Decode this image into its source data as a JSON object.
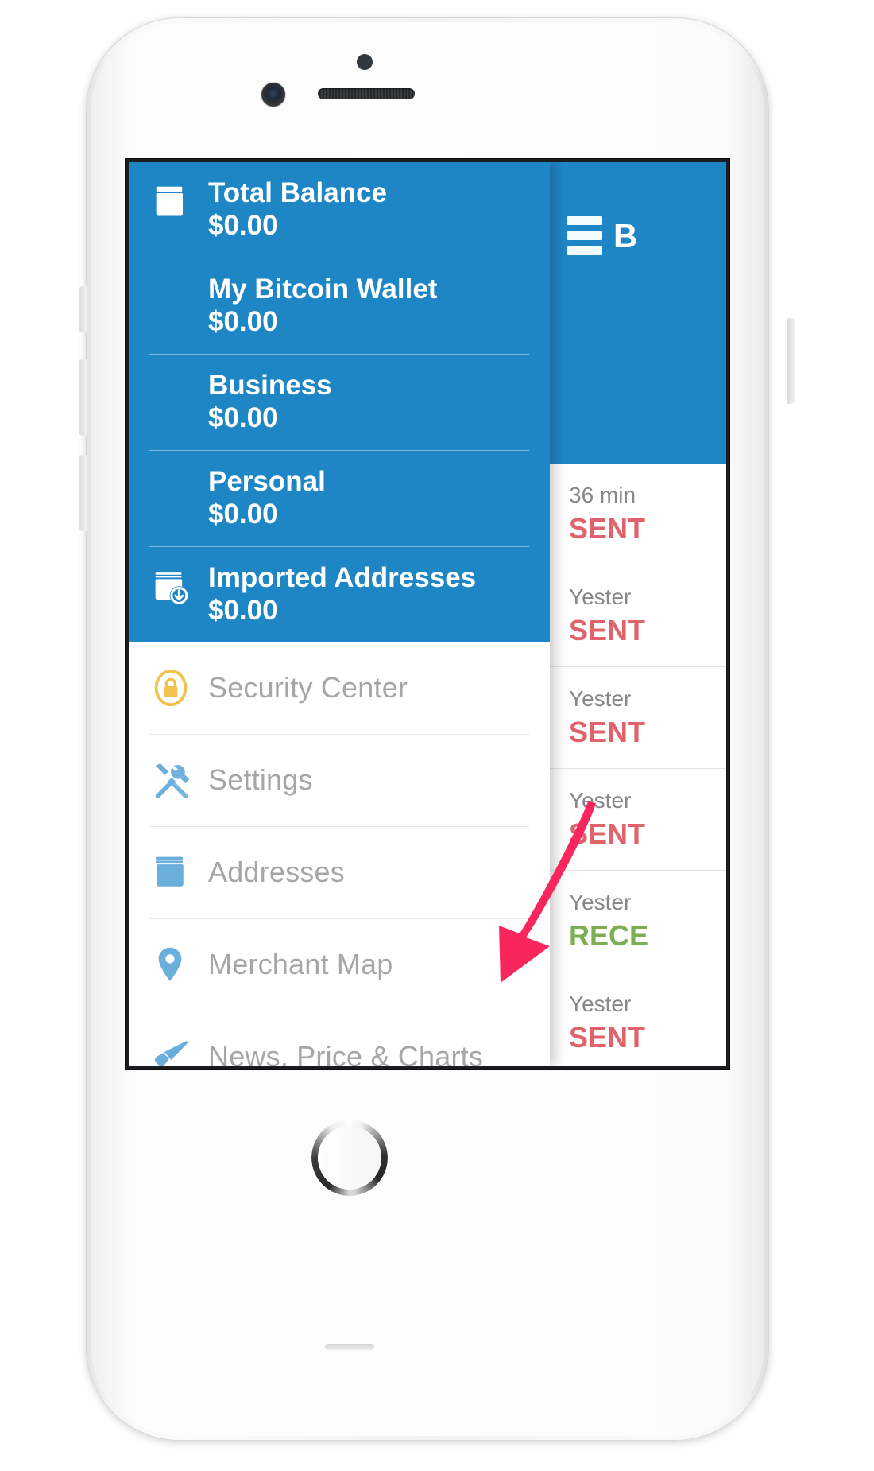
{
  "device": {
    "name": "iphone-white",
    "hardware": {
      "front_camera": "camera-icon",
      "proximity_sensor": "sensor-dot",
      "earpiece": "speaker-grille",
      "home_button": "home-button",
      "side_buttons": [
        "mute-switch",
        "volume-up",
        "volume-down",
        "power-button"
      ]
    }
  },
  "colors": {
    "brand_blue": "#1f86c6",
    "sent_red": "#e0626b",
    "received_green": "#7cae52",
    "menu_label_gray": "#a6a6a6",
    "annotation_pink": "#f9265e",
    "lock_yellow": "#f2c14e",
    "icon_blue": "#6aaedb"
  },
  "app": {
    "title": "B",
    "menu_icon": "hamburger-icon"
  },
  "drawer": {
    "wallets": [
      {
        "icon": "book-icon",
        "name": "Total Balance",
        "amount": "$0.00"
      },
      {
        "icon": "",
        "name": "My Bitcoin Wallet",
        "amount": "$0.00"
      },
      {
        "icon": "",
        "name": "Business",
        "amount": "$0.00"
      },
      {
        "icon": "",
        "name": "Personal",
        "amount": "$0.00"
      },
      {
        "icon": "book-download-icon",
        "name": "Imported Addresses",
        "amount": "$0.00"
      }
    ],
    "menu_items": [
      {
        "icon": "lock-circle-icon",
        "label": "Security Center"
      },
      {
        "icon": "tools-icon",
        "label": "Settings"
      },
      {
        "icon": "book-icon",
        "label": "Addresses"
      },
      {
        "icon": "map-pin-icon",
        "label": "Merchant Map"
      },
      {
        "icon": "megaphone-icon",
        "label": "News, Price & Charts"
      }
    ]
  },
  "transactions": [
    {
      "time": "36 min",
      "status": "SENT",
      "kind": "sent"
    },
    {
      "time": "Yester",
      "status": "SENT",
      "kind": "sent"
    },
    {
      "time": "Yester",
      "status": "SENT",
      "kind": "sent"
    },
    {
      "time": "Yester",
      "status": "SENT",
      "kind": "sent"
    },
    {
      "time": "Yester",
      "status": "RECE",
      "kind": "received"
    },
    {
      "time": "Yester",
      "status": "SENT",
      "kind": "sent"
    }
  ],
  "annotation": {
    "type": "arrow",
    "color": "#f9265e",
    "points_to": "Addresses"
  }
}
